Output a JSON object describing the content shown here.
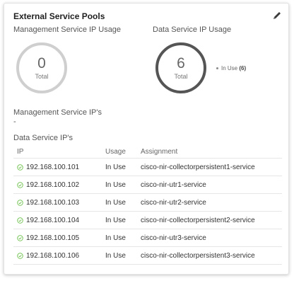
{
  "card": {
    "title": "External Service Pools",
    "edit_icon": "pencil-icon"
  },
  "management": {
    "label": "Management Service IP Usage",
    "value": "0",
    "caption": "Total",
    "ips_label": "Management Service IP's",
    "ips_value": "-"
  },
  "data_service": {
    "label": "Data Service IP Usage",
    "value": "6",
    "caption": "Total",
    "legend_label": "In Use",
    "legend_count": "(6)",
    "ips_label": "Data Service IP's"
  },
  "colors": {
    "donut_empty": "#cfcfcf",
    "donut_used": "#555555",
    "check_green": "#6cc04a"
  },
  "table": {
    "headers": {
      "ip": "IP",
      "usage": "Usage",
      "assignment": "Assignment"
    },
    "rows": [
      {
        "ip": "192.168.100.101",
        "usage": "In Use",
        "assignment": "cisco-nir-collectorpersistent1-service"
      },
      {
        "ip": "192.168.100.102",
        "usage": "In Use",
        "assignment": "cisco-nir-utr1-service"
      },
      {
        "ip": "192.168.100.103",
        "usage": "In Use",
        "assignment": "cisco-nir-utr2-service"
      },
      {
        "ip": "192.168.100.104",
        "usage": "In Use",
        "assignment": "cisco-nir-collectorpersistent2-service"
      },
      {
        "ip": "192.168.100.105",
        "usage": "In Use",
        "assignment": "cisco-nir-utr3-service"
      },
      {
        "ip": "192.168.100.106",
        "usage": "In Use",
        "assignment": "cisco-nir-collectorpersistent3-service"
      }
    ]
  }
}
